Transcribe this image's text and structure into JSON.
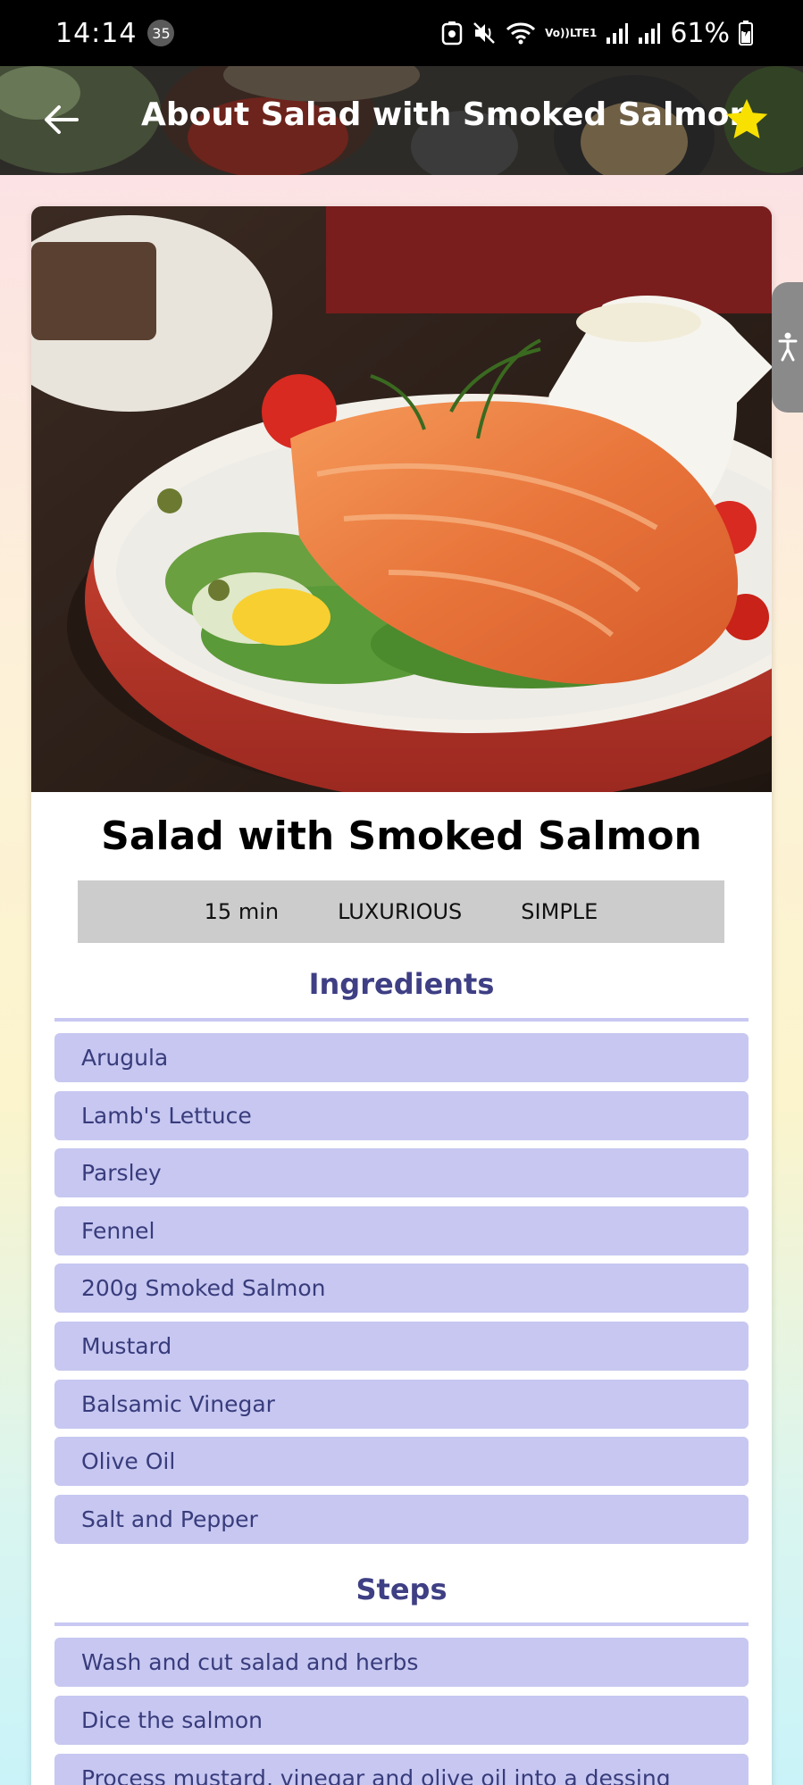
{
  "status_bar": {
    "time": "14:14",
    "notification_count": "35",
    "network_label_top": "Vo))",
    "network_label_bottom": "LTE1",
    "battery_percent": "61%"
  },
  "app_bar": {
    "title": "About Salad with Smoked Salmon",
    "accent_color": "#f8e000"
  },
  "recipe": {
    "title": "Salad with Smoked Salmon",
    "duration": "15 min",
    "affordability": "LUXURIOUS",
    "complexity": "SIMPLE"
  },
  "ingredients": {
    "header": "Ingredients",
    "items": [
      "Arugula",
      "Lamb's Lettuce",
      "Parsley",
      "Fennel",
      "200g Smoked Salmon",
      "Mustard",
      "Balsamic Vinegar",
      "Olive Oil",
      "Salt and Pepper"
    ]
  },
  "steps": {
    "header": "Steps",
    "items": [
      "Wash and cut salad and herbs",
      "Dice the salmon",
      "Process mustard, vinegar and olive oil into a dessing"
    ]
  },
  "colors": {
    "item_background": "#c7c7f1",
    "item_text": "#383c7c",
    "header_text": "#3e3f84"
  }
}
